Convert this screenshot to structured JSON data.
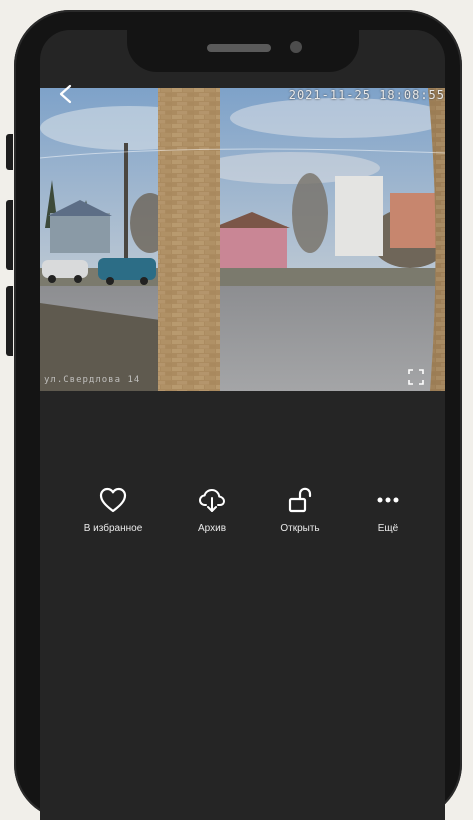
{
  "camera": {
    "timestamp": "2021-11-25  18:08:55",
    "osd_bottom": "ул.Свердлова 14"
  },
  "actions": [
    {
      "label": "В избранное",
      "icon": "heart-icon"
    },
    {
      "label": "Архив",
      "icon": "cloud-download-icon"
    },
    {
      "label": "Открыть",
      "icon": "unlock-icon"
    },
    {
      "label": "Ещё",
      "icon": "more-icon"
    }
  ],
  "colors": {
    "screen_bg": "#252525",
    "frame": "#141414",
    "page_bg": "#f1efea",
    "text": "#ffffff"
  }
}
